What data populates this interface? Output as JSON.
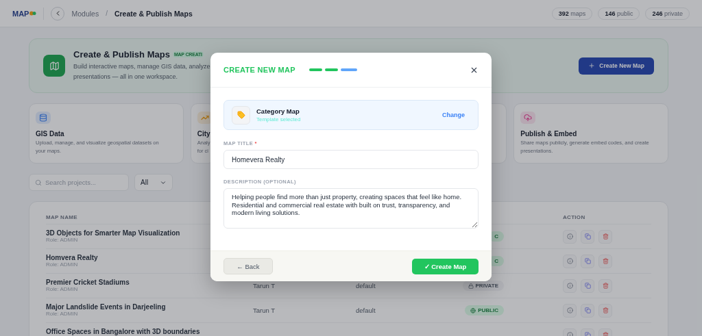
{
  "header": {
    "logo": "MAP",
    "separator": "/",
    "breadcrumb": [
      {
        "label": "Modules",
        "current": false
      },
      {
        "label": "Create & Publish Maps",
        "current": true
      }
    ],
    "stats": [
      {
        "value": "392",
        "label": "maps"
      },
      {
        "value": "146",
        "label": "public"
      },
      {
        "value": "246",
        "label": "private"
      }
    ]
  },
  "hero": {
    "title": "Create & Publish Maps",
    "badge": "MAP CREATI",
    "description": [
      "Build interactive maps, manage GIS data, analyze",
      "presentations — all in one workspace."
    ],
    "button": "Create New Map"
  },
  "features": [
    {
      "title": "GIS Data",
      "description": [
        "Upload, manage, and visualize geospatial datasets on",
        "your maps."
      ]
    },
    {
      "title": "City",
      "description": [
        "Analy",
        "for ci"
      ]
    },
    {
      "title": "Publish & Embed",
      "description": [
        "Share maps publicly, generate embed codes, and create",
        "presentations."
      ]
    }
  ],
  "search": {
    "placeholder": "Search projects...",
    "filter": "All"
  },
  "table": {
    "columns": [
      "MAP NAME",
      "ACTION"
    ],
    "rows": [
      {
        "name": "3D Objects for Smarter Map Visualization",
        "role": "Role: ADMIN",
        "status": {
          "label": "C",
          "kind": "public"
        }
      },
      {
        "name": "Homvera Realty",
        "role": "Role: ADMIN",
        "status": {
          "label": "C",
          "kind": "public"
        }
      },
      {
        "name": "Premier Cricket Stadiums",
        "role": "Role: ADMIN",
        "owner": "Tarun T",
        "template": "default",
        "status": {
          "label": "PRIVATE",
          "kind": "private"
        }
      },
      {
        "name": "Major Landslide Events in Darjeeling",
        "role": "Role: ADMIN",
        "owner": "Tarun T",
        "template": "default",
        "status": {
          "label": "PUBLIC",
          "kind": "public"
        }
      },
      {
        "name": "Office Spaces in Bangalore with 3D boundaries"
      }
    ]
  },
  "modal": {
    "title": "CREATE NEW MAP",
    "steps": [
      {
        "done": true
      },
      {
        "done": true
      },
      {
        "done": false
      }
    ],
    "template": {
      "name": "Category Map",
      "status": "Template selected",
      "action": "Change"
    },
    "title_field": {
      "label": "MAP TITLE",
      "required_mark": "*",
      "value": "Homevera Realty"
    },
    "description_field": {
      "label": "DESCRIPTION (OPTIONAL)",
      "value": "Helping people find more than just property, creating spaces that feel like home. Residential and commercial real estate with built on trust, transparency, and modern living solutions."
    },
    "back": "← Back",
    "create": "✓ Create Map"
  }
}
